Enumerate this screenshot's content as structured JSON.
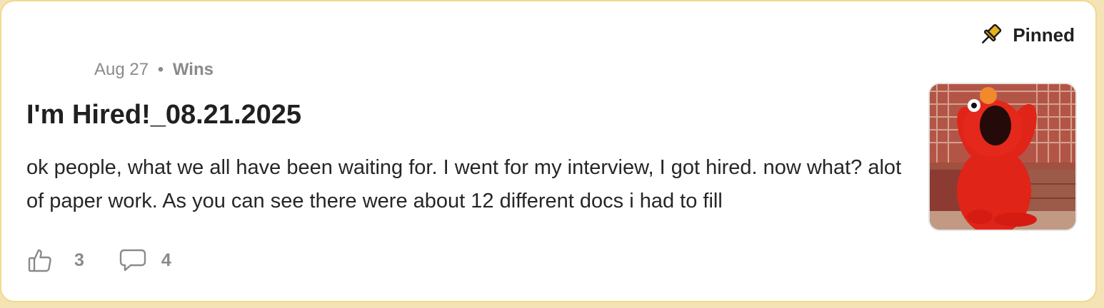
{
  "post": {
    "pinned_label": "Pinned",
    "date": "Aug 27",
    "separator": "•",
    "category": "Wins",
    "title": "I'm Hired!_08.21.2025",
    "excerpt": "ok people, what we all have been waiting for. I went for my interview, I got hired. now what? alot of paper work. As you can see there were about 12 different docs i had to fill",
    "thumbnail": {
      "description_icon": "elmo-gif-thumbnail"
    },
    "likes": "3",
    "comments": "4"
  },
  "icons": {
    "pin": "pin-icon",
    "like": "thumbs-up-icon",
    "comment": "comment-bubble-icon"
  },
  "colors": {
    "card_border": "#f1d98f",
    "pin_fill": "#e8b01e",
    "text": "#202020",
    "muted": "#8a8a8a"
  }
}
